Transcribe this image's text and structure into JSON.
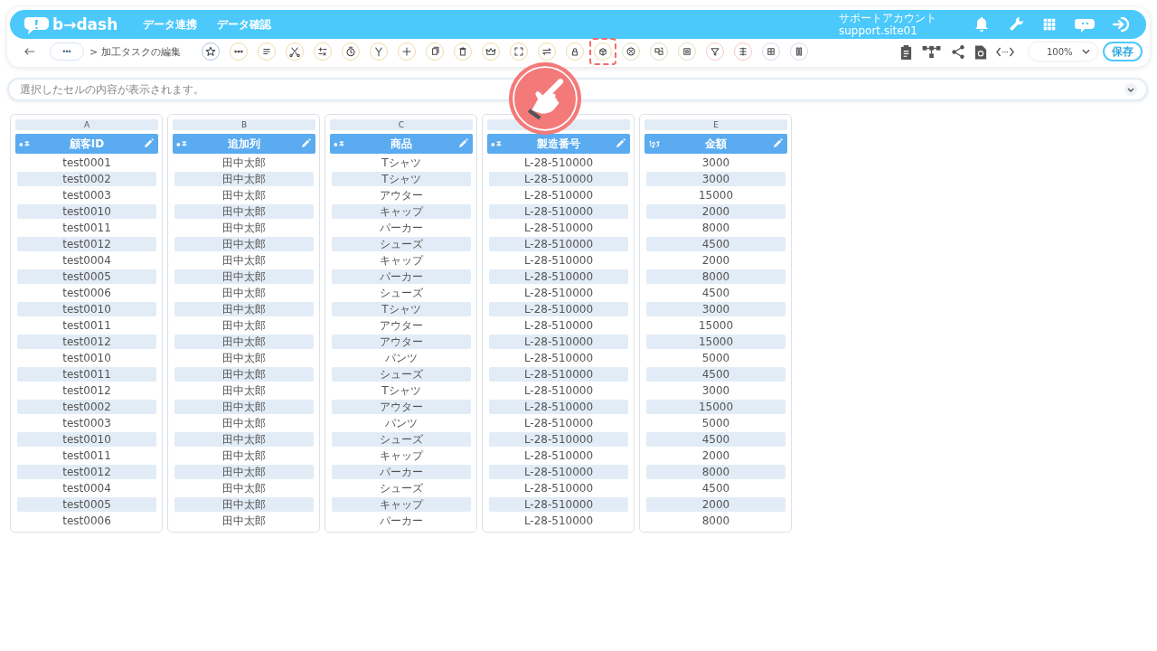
{
  "header": {
    "logo": "b→dash",
    "nav": [
      "データ連携",
      "データ確認"
    ],
    "account_name": "サポートアカウント",
    "account_id": "support.site01"
  },
  "toolbar": {
    "breadcrumb_more": "•••",
    "breadcrumb": "> 加工タスクの編集",
    "zoom": "100%",
    "save": "保存",
    "tools": [
      {
        "color": "#a8c4e0",
        "highlighted": false
      },
      {
        "color": "#f0dca8",
        "highlighted": false
      },
      {
        "color": "#f0dca8",
        "highlighted": false
      },
      {
        "color": "#f0dca8",
        "highlighted": false
      },
      {
        "color": "#f0dca8",
        "highlighted": false
      },
      {
        "color": "#f0dca8",
        "highlighted": false
      },
      {
        "color": "#f0dca8",
        "highlighted": false
      },
      {
        "color": "#f0dca8",
        "highlighted": false
      },
      {
        "color": "#f0dca8",
        "highlighted": false
      },
      {
        "color": "#f0dca8",
        "highlighted": false
      },
      {
        "color": "#f0dca8",
        "highlighted": false
      },
      {
        "color": "#f0dca8",
        "highlighted": false
      },
      {
        "color": "#f0dca8",
        "highlighted": false
      },
      {
        "color": "#f0dca8",
        "highlighted": false
      },
      {
        "color": "#f0dca8",
        "highlighted": true
      },
      {
        "color": "#d8e4c0",
        "highlighted": false
      },
      {
        "color": "#d8e4c0",
        "highlighted": false
      },
      {
        "color": "#d8e4c0",
        "highlighted": false
      },
      {
        "color": "#f8c8c8",
        "highlighted": false
      },
      {
        "color": "#f8c8c8",
        "highlighted": false
      },
      {
        "color": "#e8d0f4",
        "highlighted": false
      },
      {
        "color": "#e8d0f4",
        "highlighted": false
      }
    ]
  },
  "cell_bar": {
    "placeholder": "選択したセルの内容が表示されます。"
  },
  "columns": [
    {
      "letter": "A",
      "kind": "text",
      "title": "顧客ID",
      "cells": [
        "test0001",
        "test0002",
        "test0003",
        "test0010",
        "test0011",
        "test0012",
        "test0004",
        "test0005",
        "test0006",
        "test0010",
        "test0011",
        "test0012",
        "test0010",
        "test0011",
        "test0012",
        "test0002",
        "test0003",
        "test0010",
        "test0011",
        "test0012",
        "test0004",
        "test0005",
        "test0006"
      ]
    },
    {
      "letter": "B",
      "kind": "text",
      "title": "追加列",
      "cells": [
        "田中太郎",
        "田中太郎",
        "田中太郎",
        "田中太郎",
        "田中太郎",
        "田中太郎",
        "田中太郎",
        "田中太郎",
        "田中太郎",
        "田中太郎",
        "田中太郎",
        "田中太郎",
        "田中太郎",
        "田中太郎",
        "田中太郎",
        "田中太郎",
        "田中太郎",
        "田中太郎",
        "田中太郎",
        "田中太郎",
        "田中太郎",
        "田中太郎",
        "田中太郎"
      ]
    },
    {
      "letter": "C",
      "kind": "text",
      "title": "商品",
      "cells": [
        "Tシャツ",
        "Tシャツ",
        "アウター",
        "キャップ",
        "パーカー",
        "シューズ",
        "キャップ",
        "パーカー",
        "シューズ",
        "Tシャツ",
        "アウター",
        "アウター",
        "パンツ",
        "シューズ",
        "Tシャツ",
        "アウター",
        "パンツ",
        "シューズ",
        "キャップ",
        "パーカー",
        "シューズ",
        "キャップ",
        "パーカー"
      ]
    },
    {
      "kind": "text",
      "title": "製造番号",
      "cells": [
        "L-28-510000",
        "L-28-510000",
        "L-28-510000",
        "L-28-510000",
        "L-28-510000",
        "L-28-510000",
        "L-28-510000",
        "L-28-510000",
        "L-28-510000",
        "L-28-510000",
        "L-28-510000",
        "L-28-510000",
        "L-28-510000",
        "L-28-510000",
        "L-28-510000",
        "L-28-510000",
        "L-28-510000",
        "L-28-510000",
        "L-28-510000",
        "L-28-510000",
        "L-28-510000",
        "L-28-510000",
        "L-28-510000"
      ]
    },
    {
      "letter": "E",
      "kind": "number",
      "title": "金額",
      "cells": [
        "3000",
        "3000",
        "15000",
        "2000",
        "8000",
        "4500",
        "2000",
        "8000",
        "4500",
        "3000",
        "15000",
        "15000",
        "5000",
        "4500",
        "3000",
        "15000",
        "5000",
        "4500",
        "2000",
        "8000",
        "4500",
        "2000",
        "8000"
      ]
    }
  ]
}
